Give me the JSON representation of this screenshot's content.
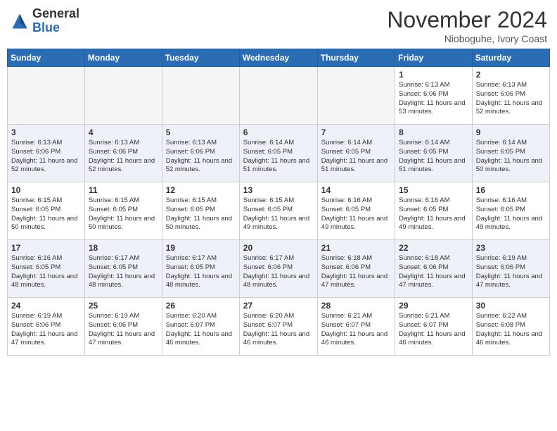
{
  "header": {
    "logo_line1": "General",
    "logo_line2": "Blue",
    "month_title": "November 2024",
    "location": "Nioboguhe, Ivory Coast"
  },
  "weekdays": [
    "Sunday",
    "Monday",
    "Tuesday",
    "Wednesday",
    "Thursday",
    "Friday",
    "Saturday"
  ],
  "weeks": [
    [
      {
        "day": "",
        "info": ""
      },
      {
        "day": "",
        "info": ""
      },
      {
        "day": "",
        "info": ""
      },
      {
        "day": "",
        "info": ""
      },
      {
        "day": "",
        "info": ""
      },
      {
        "day": "1",
        "info": "Sunrise: 6:13 AM\nSunset: 6:06 PM\nDaylight: 11 hours and 53 minutes."
      },
      {
        "day": "2",
        "info": "Sunrise: 6:13 AM\nSunset: 6:06 PM\nDaylight: 11 hours and 52 minutes."
      }
    ],
    [
      {
        "day": "3",
        "info": "Sunrise: 6:13 AM\nSunset: 6:06 PM\nDaylight: 11 hours and 52 minutes."
      },
      {
        "day": "4",
        "info": "Sunrise: 6:13 AM\nSunset: 6:06 PM\nDaylight: 11 hours and 52 minutes."
      },
      {
        "day": "5",
        "info": "Sunrise: 6:13 AM\nSunset: 6:06 PM\nDaylight: 11 hours and 52 minutes."
      },
      {
        "day": "6",
        "info": "Sunrise: 6:14 AM\nSunset: 6:05 PM\nDaylight: 11 hours and 51 minutes."
      },
      {
        "day": "7",
        "info": "Sunrise: 6:14 AM\nSunset: 6:05 PM\nDaylight: 11 hours and 51 minutes."
      },
      {
        "day": "8",
        "info": "Sunrise: 6:14 AM\nSunset: 6:05 PM\nDaylight: 11 hours and 51 minutes."
      },
      {
        "day": "9",
        "info": "Sunrise: 6:14 AM\nSunset: 6:05 PM\nDaylight: 11 hours and 50 minutes."
      }
    ],
    [
      {
        "day": "10",
        "info": "Sunrise: 6:15 AM\nSunset: 6:05 PM\nDaylight: 11 hours and 50 minutes."
      },
      {
        "day": "11",
        "info": "Sunrise: 6:15 AM\nSunset: 6:05 PM\nDaylight: 11 hours and 50 minutes."
      },
      {
        "day": "12",
        "info": "Sunrise: 6:15 AM\nSunset: 6:05 PM\nDaylight: 11 hours and 50 minutes."
      },
      {
        "day": "13",
        "info": "Sunrise: 6:15 AM\nSunset: 6:05 PM\nDaylight: 11 hours and 49 minutes."
      },
      {
        "day": "14",
        "info": "Sunrise: 6:16 AM\nSunset: 6:05 PM\nDaylight: 11 hours and 49 minutes."
      },
      {
        "day": "15",
        "info": "Sunrise: 6:16 AM\nSunset: 6:05 PM\nDaylight: 11 hours and 49 minutes."
      },
      {
        "day": "16",
        "info": "Sunrise: 6:16 AM\nSunset: 6:05 PM\nDaylight: 11 hours and 49 minutes."
      }
    ],
    [
      {
        "day": "17",
        "info": "Sunrise: 6:16 AM\nSunset: 6:05 PM\nDaylight: 11 hours and 48 minutes."
      },
      {
        "day": "18",
        "info": "Sunrise: 6:17 AM\nSunset: 6:05 PM\nDaylight: 11 hours and 48 minutes."
      },
      {
        "day": "19",
        "info": "Sunrise: 6:17 AM\nSunset: 6:05 PM\nDaylight: 11 hours and 48 minutes."
      },
      {
        "day": "20",
        "info": "Sunrise: 6:17 AM\nSunset: 6:06 PM\nDaylight: 11 hours and 48 minutes."
      },
      {
        "day": "21",
        "info": "Sunrise: 6:18 AM\nSunset: 6:06 PM\nDaylight: 11 hours and 47 minutes."
      },
      {
        "day": "22",
        "info": "Sunrise: 6:18 AM\nSunset: 6:06 PM\nDaylight: 11 hours and 47 minutes."
      },
      {
        "day": "23",
        "info": "Sunrise: 6:19 AM\nSunset: 6:06 PM\nDaylight: 11 hours and 47 minutes."
      }
    ],
    [
      {
        "day": "24",
        "info": "Sunrise: 6:19 AM\nSunset: 6:06 PM\nDaylight: 11 hours and 47 minutes."
      },
      {
        "day": "25",
        "info": "Sunrise: 6:19 AM\nSunset: 6:06 PM\nDaylight: 11 hours and 47 minutes."
      },
      {
        "day": "26",
        "info": "Sunrise: 6:20 AM\nSunset: 6:07 PM\nDaylight: 11 hours and 46 minutes."
      },
      {
        "day": "27",
        "info": "Sunrise: 6:20 AM\nSunset: 6:07 PM\nDaylight: 11 hours and 46 minutes."
      },
      {
        "day": "28",
        "info": "Sunrise: 6:21 AM\nSunset: 6:07 PM\nDaylight: 11 hours and 46 minutes."
      },
      {
        "day": "29",
        "info": "Sunrise: 6:21 AM\nSunset: 6:07 PM\nDaylight: 11 hours and 46 minutes."
      },
      {
        "day": "30",
        "info": "Sunrise: 6:22 AM\nSunset: 6:08 PM\nDaylight: 11 hours and 46 minutes."
      }
    ]
  ]
}
